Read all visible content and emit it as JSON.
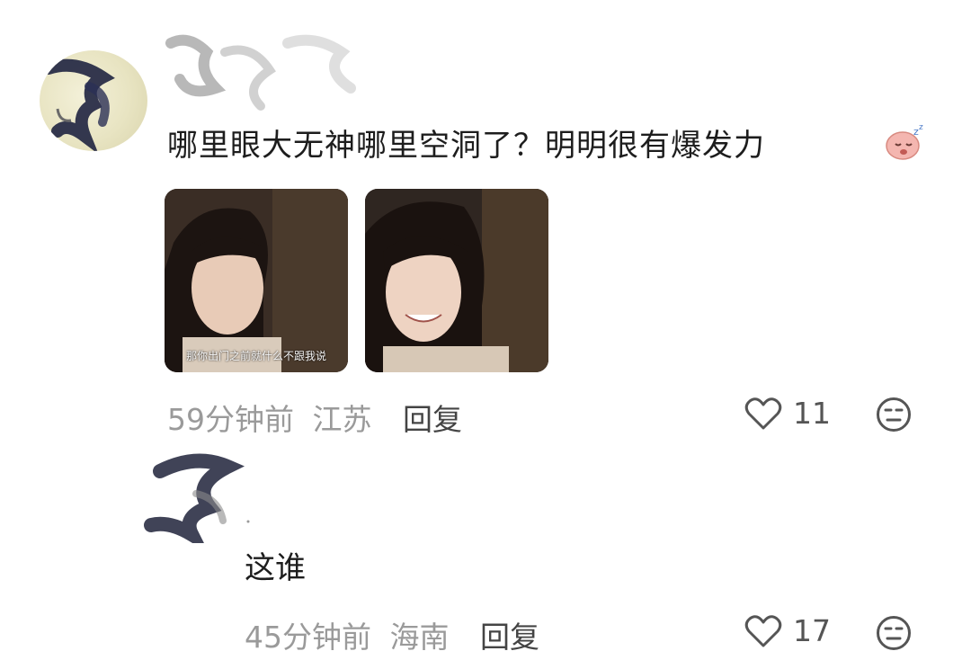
{
  "comments": [
    {
      "text": "哪里眼大无神哪里空洞了？明明很有爆发力",
      "emoji": "sleepy-face-emoji",
      "images": [
        {
          "subtitle": "那你出门之前就什么不跟我说"
        },
        {
          "subtitle": ""
        }
      ],
      "time": "59分钟前",
      "location": "江苏",
      "reply_label": "回复",
      "likes": "11"
    },
    {
      "text": "这谁",
      "time": "45分钟前",
      "location": "海南",
      "reply_label": "回复",
      "likes": "17"
    }
  ],
  "icons": {
    "like": "heart-outline-icon",
    "dislike": "meh-face-icon"
  }
}
